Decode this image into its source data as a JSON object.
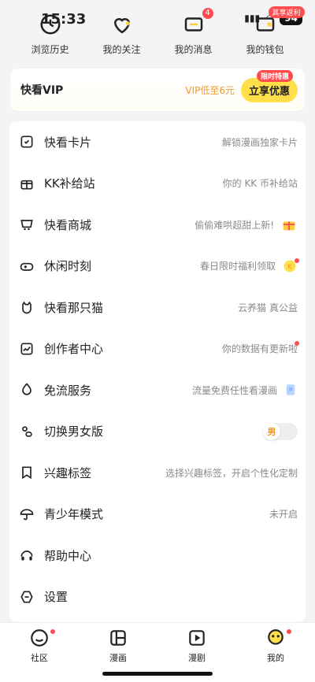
{
  "status": {
    "time": "15:33",
    "battery": "94"
  },
  "quick_links": [
    {
      "label": "浏览历史"
    },
    {
      "label": "我的关注"
    },
    {
      "label": "我的消息",
      "badge": "4"
    },
    {
      "label": "我的钱包",
      "tag": "其享返利"
    }
  ],
  "vip": {
    "title": "快看VIP",
    "desc": "VIP低至6元",
    "button": "立享优惠",
    "tag": "限时特惠"
  },
  "menu": [
    {
      "label": "快看卡片",
      "desc": "解锁漫画独家卡片"
    },
    {
      "label": "KK补给站",
      "desc": "你的 KK 币补给站"
    },
    {
      "label": "快看商城",
      "desc": "偷偷难哄超甜上新!"
    },
    {
      "label": "休闲时刻",
      "desc": "春日限时福利领取"
    },
    {
      "label": "快看那只猫",
      "desc": "云养猫 真公益"
    },
    {
      "label": "创作者中心",
      "desc": "你的数据有更新啦"
    },
    {
      "label": "免流服务",
      "desc": "流量免费任性看漫画"
    },
    {
      "label": "切换男女版",
      "toggle": "男"
    },
    {
      "label": "兴趣标签",
      "desc": "选择兴趣标签，开启个性化定制"
    },
    {
      "label": "青少年模式",
      "desc": "未开启"
    },
    {
      "label": "帮助中心",
      "desc": ""
    },
    {
      "label": "设置",
      "desc": ""
    }
  ],
  "tabs": [
    {
      "label": "社区"
    },
    {
      "label": "漫画"
    },
    {
      "label": "漫剧"
    },
    {
      "label": "我的"
    }
  ],
  "colors": {
    "accent_yellow": "#ffe04a",
    "vip_text": "#f09a28",
    "badge_red": "#ff4d4f"
  }
}
